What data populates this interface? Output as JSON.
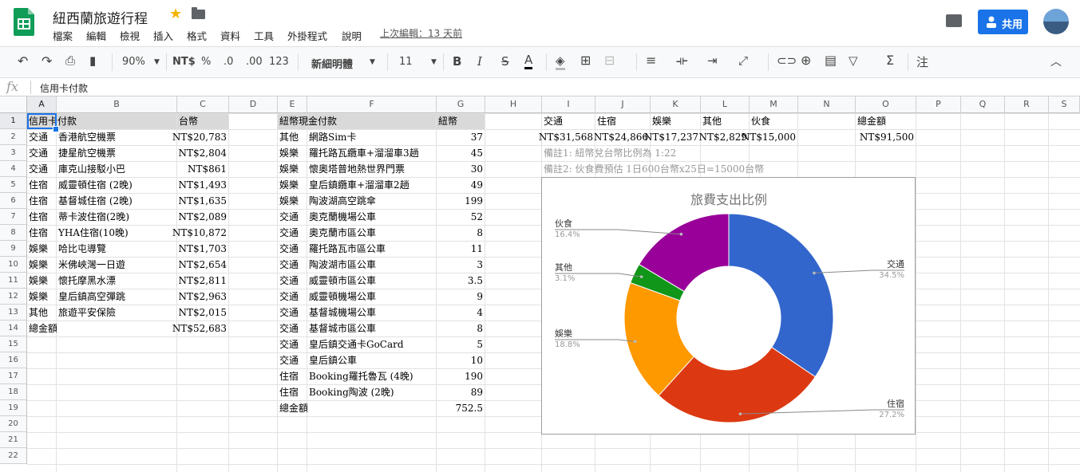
{
  "doc": {
    "title": "紐西蘭旅遊行程",
    "last_edit": "上次編輯：13 天前",
    "share_label": "共用"
  },
  "menus": [
    "檔案",
    "編輯",
    "檢視",
    "插入",
    "格式",
    "資料",
    "工具",
    "外掛程式",
    "說明"
  ],
  "toolbar": {
    "zoom": "90%",
    "currency": "NT$",
    "percent": "%",
    "dec_less": ".0",
    "dec_more": ".00",
    "format": "123",
    "font": "新細明體",
    "size": "11",
    "bold": "B",
    "italic": "I",
    "strike": "S",
    "textcolor": "A",
    "input_tools": "注"
  },
  "formula": {
    "fx": "fx",
    "value": "信用卡付款"
  },
  "columns": [
    "A",
    "B",
    "C",
    "D",
    "E",
    "F",
    "G",
    "H",
    "I",
    "J",
    "K",
    "L",
    "M",
    "N",
    "O",
    "P",
    "Q",
    "R",
    "S"
  ],
  "rows": [
    "1",
    "2",
    "3",
    "4",
    "5",
    "6",
    "7",
    "8",
    "9",
    "10",
    "11",
    "12",
    "13",
    "14",
    "15",
    "16",
    "17",
    "18",
    "19",
    "20",
    "21",
    "22"
  ],
  "sheet": {
    "a1": "信用卡付款",
    "c1": "台幣",
    "e1": "紐幣現金付款",
    "g1": "紐幣",
    "credit": [
      {
        "cat": "交通",
        "item": "香港航空機票",
        "amt": "NT$20,783"
      },
      {
        "cat": "交通",
        "item": "捷星航空機票",
        "amt": "NT$2,804"
      },
      {
        "cat": "交通",
        "item": "庫克山接駁小巴",
        "amt": "NT$861"
      },
      {
        "cat": "住宿",
        "item": "威靈頓住宿 (2晚)",
        "amt": "NT$1,493"
      },
      {
        "cat": "住宿",
        "item": "基督城住宿 (2晚)",
        "amt": "NT$1,635"
      },
      {
        "cat": "住宿",
        "item": "蒂卡波住宿(2晚)",
        "amt": "NT$2,089"
      },
      {
        "cat": "住宿",
        "item": "YHA住宿(10晚)",
        "amt": "NT$10,872"
      },
      {
        "cat": "娛樂",
        "item": "哈比屯導覽",
        "amt": "NT$1,703"
      },
      {
        "cat": "娛樂",
        "item": "米佛峽灣一日遊",
        "amt": "NT$2,654"
      },
      {
        "cat": "娛樂",
        "item": "懷托摩黑水漂",
        "amt": "NT$2,811"
      },
      {
        "cat": "娛樂",
        "item": "皇后鎮高空彈跳",
        "amt": "NT$2,963"
      },
      {
        "cat": "其他",
        "item": "旅遊平安保險",
        "amt": "NT$2,015"
      }
    ],
    "credit_total_label": "總金額",
    "credit_total": "NT$52,683",
    "cash": [
      {
        "cat": "其他",
        "item": "網路Sim卡",
        "amt": "37"
      },
      {
        "cat": "娛樂",
        "item": "羅托路瓦纜車+溜溜車3趟",
        "amt": "45"
      },
      {
        "cat": "娛樂",
        "item": "懷奧塔普地熱世界門票",
        "amt": "30"
      },
      {
        "cat": "娛樂",
        "item": "皇后鎮纜車+溜溜車2趟",
        "amt": "49"
      },
      {
        "cat": "娛樂",
        "item": "陶波湖高空跳傘",
        "amt": "199"
      },
      {
        "cat": "交通",
        "item": "奧克蘭機場公車",
        "amt": "52"
      },
      {
        "cat": "交通",
        "item": "奧克蘭市區公車",
        "amt": "8"
      },
      {
        "cat": "交通",
        "item": "羅托路瓦市區公車",
        "amt": "11"
      },
      {
        "cat": "交通",
        "item": "陶波湖市區公車",
        "amt": "3"
      },
      {
        "cat": "交通",
        "item": "威靈頓市區公車",
        "amt": "3.5"
      },
      {
        "cat": "交通",
        "item": "威靈頓機場公車",
        "amt": "9"
      },
      {
        "cat": "交通",
        "item": "基督城機場公車",
        "amt": "4"
      },
      {
        "cat": "交通",
        "item": "基督城市區公車",
        "amt": "8"
      },
      {
        "cat": "交通",
        "item": "皇后鎮交通卡GoCard",
        "amt": "5"
      },
      {
        "cat": "交通",
        "item": "皇后鎮公車",
        "amt": "10"
      },
      {
        "cat": "住宿",
        "item": "Booking羅托魯瓦 (4晚)",
        "amt": "190"
      },
      {
        "cat": "住宿",
        "item": "Booking陶波 (2晚)",
        "amt": "89"
      }
    ],
    "cash_total_label": "總金額",
    "cash_total": "752.5",
    "summary_headers": [
      "交通",
      "住宿",
      "娛樂",
      "其他",
      "伙食",
      "",
      "總金額"
    ],
    "summary_values": [
      "NT$31,568",
      "NT$24,866",
      "NT$17,237",
      "NT$2,829",
      "NT$15,000",
      "",
      "NT$91,500"
    ],
    "note1": "備註1: 紐幣兌台幣比例為 1:22",
    "note2": "備註2: 伙食費預估 1日600台幣x25日=15000台幣"
  },
  "chart_data": {
    "type": "pie",
    "donut": true,
    "title": "旅費支出比例",
    "categories": [
      "交通",
      "住宿",
      "娛樂",
      "其他",
      "伙食"
    ],
    "values": [
      34.5,
      27.2,
      18.8,
      3.1,
      16.4
    ],
    "labels": [
      "34.5%",
      "27.2%",
      "18.8%",
      "3.1%",
      "16.4%"
    ],
    "colors": [
      "#3366cc",
      "#dc3912",
      "#ff9900",
      "#109618",
      "#990099"
    ]
  }
}
